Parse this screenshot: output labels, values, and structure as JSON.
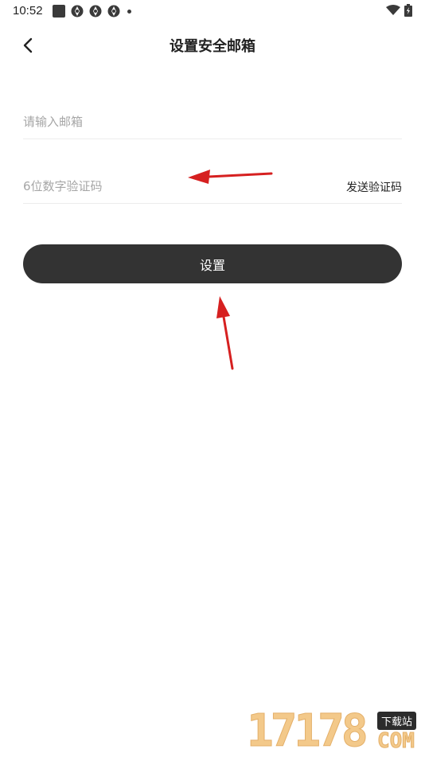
{
  "status_bar": {
    "time": "10:52",
    "left_icons": [
      "notification-square-icon",
      "aperture-icon",
      "aperture-icon",
      "aperture-icon",
      "dot-icon"
    ],
    "right_icons": [
      "wifi-icon",
      "battery-icon"
    ]
  },
  "header": {
    "title": "设置安全邮箱",
    "back_icon": "chevron-left-icon"
  },
  "form": {
    "email_placeholder": "请输入邮箱",
    "email_value": "",
    "code_placeholder": "6位数字验证码",
    "code_value": "",
    "send_code_label": "发送验证码",
    "submit_label": "设置"
  },
  "watermark": {
    "number": "17178",
    "badge": "下载站",
    "domain": "COM"
  },
  "colors": {
    "button_bg": "#333333",
    "annotation_arrow": "#d62020",
    "placeholder": "#a6a6a6"
  }
}
